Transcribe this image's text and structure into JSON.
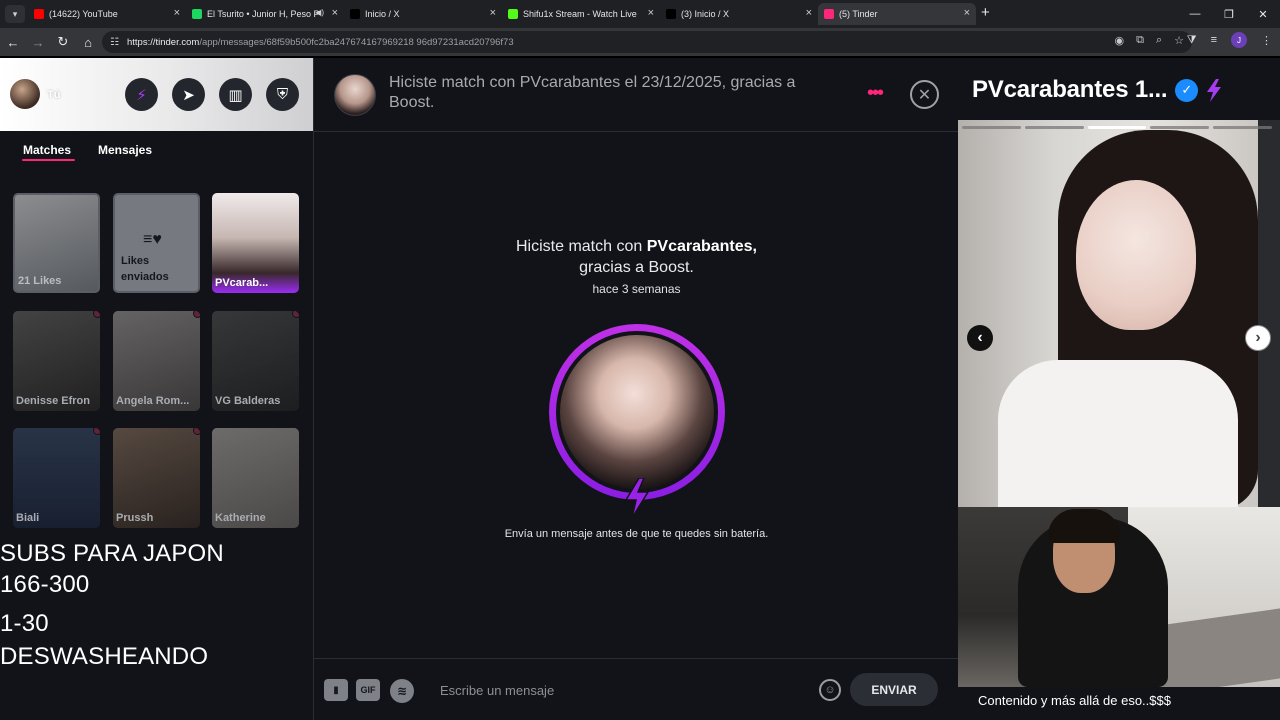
{
  "browser": {
    "tabs": [
      {
        "title": "(14622) YouTube",
        "favicon": "youtube-icon",
        "color": "#ff0000"
      },
      {
        "title": "El Tsurito • Junior H, Peso P",
        "favicon": "spotify-icon",
        "color": "#1ed760"
      },
      {
        "title": "Inicio / X",
        "favicon": "x-icon",
        "color": "#000000"
      },
      {
        "title": "Shifu1x Stream - Watch Live on",
        "favicon": "kick-icon",
        "color": "#53fc18"
      },
      {
        "title": "(3) Inicio / X",
        "favicon": "x-icon",
        "color": "#000000"
      },
      {
        "title": "(5) Tinder",
        "favicon": "tinder-icon",
        "color": "#fd267a"
      }
    ],
    "active_tab": 5,
    "url_host": "https://tinder.com",
    "url_path": "/app/messages/68f59b500fc2ba247674167969218 96d97231acd20796f73",
    "profile_initial": "J"
  },
  "sidebar": {
    "me_label": "Tú",
    "tabs": [
      "Matches",
      "Mensajes"
    ],
    "likes_label": "21 Likes",
    "sent_label": "Likes enviados",
    "matches": [
      {
        "name": "PVcarab..."
      },
      {
        "name": "Denisse Efron"
      },
      {
        "name": "Angela Rom..."
      },
      {
        "name": "VG Balderas"
      },
      {
        "name": "Biali"
      },
      {
        "name": "Prussh"
      },
      {
        "name": "Katherine"
      }
    ]
  },
  "overlay": {
    "line1": "SUBS PARA JAPON",
    "line2": "166-300",
    "line3": "1-30",
    "line4": "DESWASHEANDO"
  },
  "chat": {
    "header_title": "Hiciste match con PVcarabantes el 23/12/2025, gracias a Boost.",
    "match_prefix": "Hiciste match con ",
    "match_name": "PVcarabantes,",
    "match_suffix": "gracias a Boost.",
    "ago": "hace 3 semanas",
    "hint": "Envía un mensaje antes de que te quedes sin batería.",
    "input_placeholder": "Escribe un mensaje",
    "gif_label": "GIF",
    "send_label": "ENVIAR"
  },
  "profile": {
    "name": "PVcarabantes 1...",
    "photo_count": 5,
    "photo_index": 3
  },
  "webcam_caption": "Contenido y más allá de eso..$$$",
  "colors": {
    "brand": "#fd267a",
    "boost": "#a53cf0",
    "verified": "#1a8cff"
  }
}
